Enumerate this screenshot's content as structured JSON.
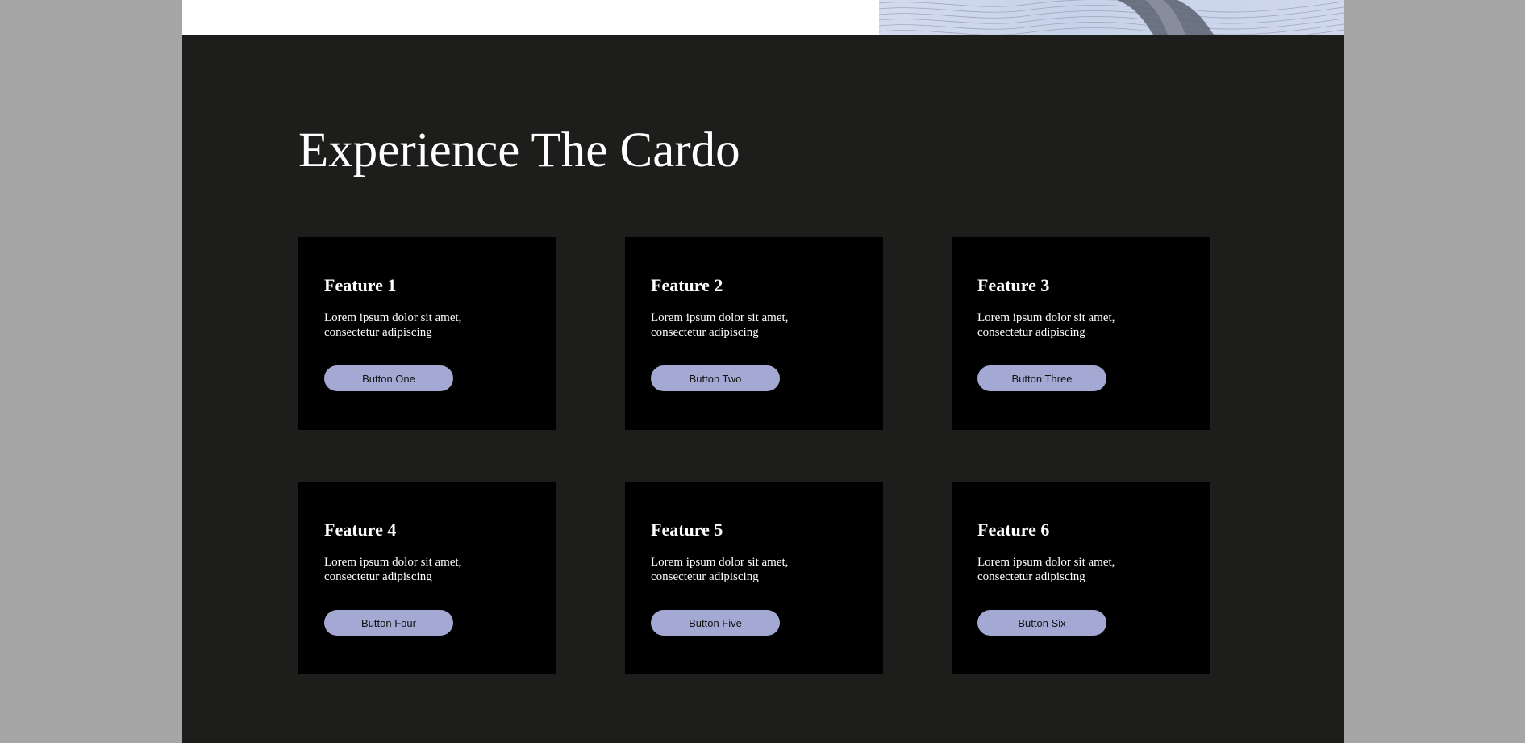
{
  "hero": {
    "image": "wavy-lines-hero-image",
    "colors": {
      "image_background": "#cfd8ec",
      "image_lines": "#8f97a8"
    }
  },
  "section": {
    "heading": "Experience The Cardo",
    "colors": {
      "background": "#1d1d1c",
      "card_background": "#000000",
      "button_background": "#a3a9d3",
      "text": "#ffffff"
    }
  },
  "features": [
    {
      "title": "Feature 1",
      "description": "Lorem ipsum dolor sit amet, consectetur adipiscing",
      "button_label": "Button One"
    },
    {
      "title": "Feature 2",
      "description": "Lorem ipsum dolor sit amet, consectetur adipiscing",
      "button_label": "Button Two"
    },
    {
      "title": "Feature 3",
      "description": "Lorem ipsum dolor sit amet, consectetur adipiscing",
      "button_label": "Button Three"
    },
    {
      "title": "Feature 4",
      "description": "Lorem ipsum dolor sit amet, consectetur adipiscing",
      "button_label": "Button Four"
    },
    {
      "title": "Feature 5",
      "description": "Lorem ipsum dolor sit amet, consectetur adipiscing",
      "button_label": "Button Five"
    },
    {
      "title": "Feature 6",
      "description": "Lorem ipsum dolor sit amet, consectetur adipiscing",
      "button_label": "Button Six"
    }
  ]
}
